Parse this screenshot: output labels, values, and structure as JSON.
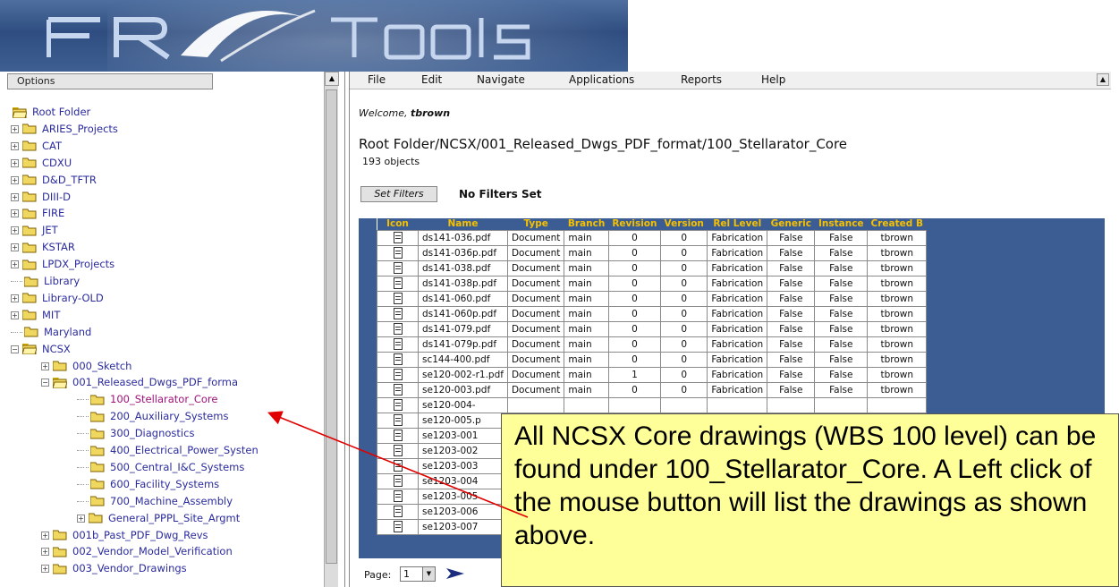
{
  "header": {
    "logo_text": "FR Tools",
    "accent": "#2f4d80"
  },
  "left_panel": {
    "options_label": "Options",
    "tree": [
      {
        "label": "Root Folder",
        "expander": "",
        "indent": 0
      },
      {
        "label": "ARIES_Projects",
        "expander": "+",
        "indent": 1
      },
      {
        "label": "CAT",
        "expander": "+",
        "indent": 1
      },
      {
        "label": "CDXU",
        "expander": "+",
        "indent": 1
      },
      {
        "label": "D&D_TFTR",
        "expander": "+",
        "indent": 1
      },
      {
        "label": "DIII-D",
        "expander": "+",
        "indent": 1
      },
      {
        "label": "FIRE",
        "expander": "+",
        "indent": 1
      },
      {
        "label": "JET",
        "expander": "+",
        "indent": 1
      },
      {
        "label": "KSTAR",
        "expander": "+",
        "indent": 1
      },
      {
        "label": "LPDX_Projects",
        "expander": "+",
        "indent": 1
      },
      {
        "label": "Library",
        "expander": "",
        "indent": 1
      },
      {
        "label": "Library-OLD",
        "expander": "+",
        "indent": 1
      },
      {
        "label": "MIT",
        "expander": "+",
        "indent": 1
      },
      {
        "label": "Maryland",
        "expander": "",
        "indent": 1
      },
      {
        "label": "NCSX",
        "expander": "-",
        "indent": 1
      },
      {
        "label": "000_Sketch",
        "expander": "+",
        "indent": 2
      },
      {
        "label": "001_Released_Dwgs_PDF_forma",
        "expander": "-",
        "indent": 2
      },
      {
        "label": "100_Stellarator_Core",
        "expander": "",
        "indent": 3,
        "selected": true
      },
      {
        "label": "200_Auxiliary_Systems",
        "expander": "",
        "indent": 3
      },
      {
        "label": "300_Diagnostics",
        "expander": "",
        "indent": 3
      },
      {
        "label": "400_Electrical_Power_Systen",
        "expander": "",
        "indent": 3
      },
      {
        "label": "500_Central_I&C_Systems",
        "expander": "",
        "indent": 3
      },
      {
        "label": "600_Facility_Systems",
        "expander": "",
        "indent": 3
      },
      {
        "label": "700_Machine_Assembly",
        "expander": "",
        "indent": 3
      },
      {
        "label": "General_PPPL_Site_Argmt",
        "expander": "+",
        "indent": 3
      },
      {
        "label": "001b_Past_PDF_Dwg_Revs",
        "expander": "+",
        "indent": 2
      },
      {
        "label": "002_Vendor_Model_Verification",
        "expander": "+",
        "indent": 2
      },
      {
        "label": "003_Vendor_Drawings",
        "expander": "+",
        "indent": 2
      }
    ]
  },
  "menu": [
    "File",
    "Edit",
    "Navigate",
    "Applications",
    "Reports",
    "Help"
  ],
  "main": {
    "welcome_prefix": "Welcome,",
    "welcome_user": "tbrown",
    "path": "Root Folder/NCSX/001_Released_Dwgs_PDF_format/100_Stellarator_Core",
    "object_count": "193 objects",
    "set_filters_label": "Set Filters",
    "filters_status": "No Filters Set",
    "columns": [
      "Icon",
      "Name",
      "Type",
      "Branch",
      "Revision",
      "Version",
      "Rel Level",
      "Generic",
      "Instance",
      "Created B"
    ],
    "rows": [
      [
        "ds141-036.pdf",
        "Document",
        "main",
        "0",
        "0",
        "Fabrication",
        "False",
        "False",
        "tbrown"
      ],
      [
        "ds141-036p.pdf",
        "Document",
        "main",
        "0",
        "0",
        "Fabrication",
        "False",
        "False",
        "tbrown"
      ],
      [
        "ds141-038.pdf",
        "Document",
        "main",
        "0",
        "0",
        "Fabrication",
        "False",
        "False",
        "tbrown"
      ],
      [
        "ds141-038p.pdf",
        "Document",
        "main",
        "0",
        "0",
        "Fabrication",
        "False",
        "False",
        "tbrown"
      ],
      [
        "ds141-060.pdf",
        "Document",
        "main",
        "0",
        "0",
        "Fabrication",
        "False",
        "False",
        "tbrown"
      ],
      [
        "ds141-060p.pdf",
        "Document",
        "main",
        "0",
        "0",
        "Fabrication",
        "False",
        "False",
        "tbrown"
      ],
      [
        "ds141-079.pdf",
        "Document",
        "main",
        "0",
        "0",
        "Fabrication",
        "False",
        "False",
        "tbrown"
      ],
      [
        "ds141-079p.pdf",
        "Document",
        "main",
        "0",
        "0",
        "Fabrication",
        "False",
        "False",
        "tbrown"
      ],
      [
        "sc144-400.pdf",
        "Document",
        "main",
        "0",
        "0",
        "Fabrication",
        "False",
        "False",
        "tbrown"
      ],
      [
        "se120-002-r1.pdf",
        "Document",
        "main",
        "1",
        "0",
        "Fabrication",
        "False",
        "False",
        "tbrown"
      ],
      [
        "se120-003.pdf",
        "Document",
        "main",
        "0",
        "0",
        "Fabrication",
        "False",
        "False",
        "tbrown"
      ],
      [
        "se120-004-",
        "",
        "",
        "",
        "",
        "",
        "",
        "",
        ""
      ],
      [
        "se120-005.p",
        "",
        "",
        "",
        "",
        "",
        "",
        "",
        ""
      ],
      [
        "se1203-001",
        "",
        "",
        "",
        "",
        "",
        "",
        "",
        ""
      ],
      [
        "se1203-002",
        "",
        "",
        "",
        "",
        "",
        "",
        "",
        ""
      ],
      [
        "se1203-003",
        "",
        "",
        "",
        "",
        "",
        "",
        "",
        ""
      ],
      [
        "se1203-004",
        "",
        "",
        "",
        "",
        "",
        "",
        "",
        ""
      ],
      [
        "se1203-005",
        "",
        "",
        "",
        "",
        "",
        "",
        "",
        ""
      ],
      [
        "se1203-006",
        "",
        "",
        "",
        "",
        "",
        "",
        "",
        ""
      ],
      [
        "se1203-007",
        "",
        "",
        "",
        "",
        "",
        "",
        "",
        ""
      ]
    ],
    "page_label": "Page:",
    "page_value": "1"
  },
  "callout": {
    "text": "All NCSX Core drawings (WBS 100 level) can be found under 100_Stellarator_Core.  A Left click of the mouse button will list the drawings as shown above."
  }
}
